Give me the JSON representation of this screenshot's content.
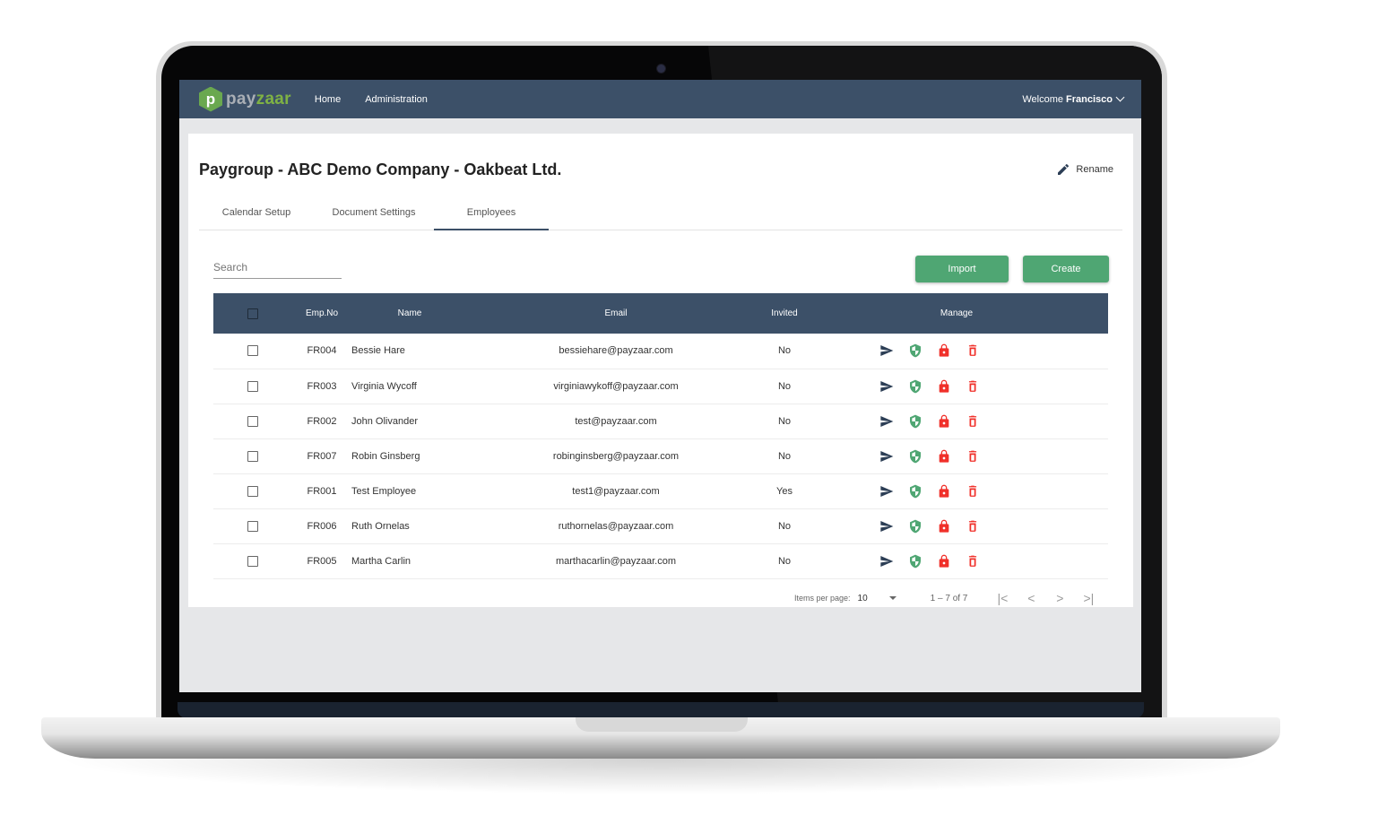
{
  "app": {
    "brand_prefix": "pay",
    "brand_suffix": "zaar",
    "logo_letter": "p",
    "nav": [
      {
        "label": "Home"
      },
      {
        "label": "Administration"
      }
    ],
    "welcome_prefix": "Welcome",
    "user_name": "Francisco"
  },
  "page": {
    "title": "Paygroup - ABC Demo Company - Oakbeat Ltd.",
    "rename_label": "Rename",
    "tabs": [
      {
        "label": "Calendar Setup",
        "active": false
      },
      {
        "label": "Document Settings",
        "active": false
      },
      {
        "label": "Employees",
        "active": true
      }
    ],
    "search_placeholder": "Search",
    "import_label": "Import",
    "create_label": "Create"
  },
  "table": {
    "columns": [
      "Emp.No",
      "Name",
      "Email",
      "Invited",
      "Manage"
    ],
    "rows": [
      {
        "emp_no": "FR004",
        "name": "Bessie Hare",
        "email": "bessiehare@payzaar.com",
        "invited": "No"
      },
      {
        "emp_no": "FR003",
        "name": "Virginia Wycoff",
        "email": "virginiawykoff@payzaar.com",
        "invited": "No"
      },
      {
        "emp_no": "FR002",
        "name": "John Olivander",
        "email": "test@payzaar.com",
        "invited": "No"
      },
      {
        "emp_no": "FR007",
        "name": "Robin Ginsberg",
        "email": "robinginsberg@payzaar.com",
        "invited": "No"
      },
      {
        "emp_no": "FR001",
        "name": "Test Employee",
        "email": "test1@payzaar.com",
        "invited": "Yes"
      },
      {
        "emp_no": "FR006",
        "name": "Ruth Ornelas",
        "email": "ruthornelas@payzaar.com",
        "invited": "No"
      },
      {
        "emp_no": "FR005",
        "name": "Martha Carlin",
        "email": "marthacarlin@payzaar.com",
        "invited": "No"
      }
    ],
    "manage_icons": [
      "send-invite-icon",
      "shield-icon",
      "lock-icon",
      "delete-icon"
    ]
  },
  "pagination": {
    "items_per_page_label": "Items per page:",
    "items_per_page": "10",
    "range": "1 – 7 of 7",
    "first": "|<",
    "prev": "<",
    "next": ">",
    "last": ">|"
  },
  "colors": {
    "nav_bg": "#3c5068",
    "button_green": "#4fa673",
    "send_icon": "#2c3e55",
    "shield_icon": "#4fa673",
    "lock_icon": "#f0302a",
    "delete_icon": "#f0302a"
  }
}
